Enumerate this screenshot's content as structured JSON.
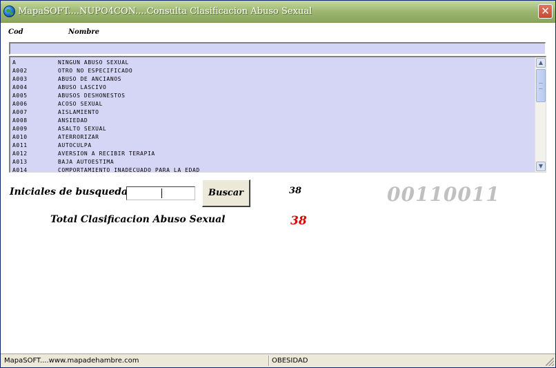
{
  "window": {
    "title": "MapaSOFT....NUPO4CON....Consulta  Clasificacion Abuso Sexual",
    "close_glyph": "✕"
  },
  "list": {
    "col_code": "Cod",
    "col_name": "Nombre",
    "search_value": "",
    "rows": [
      {
        "code": "A",
        "name": "NINGUN ABUSO SEXUAL"
      },
      {
        "code": "A002",
        "name": "OTRO NO ESPECIFICADO"
      },
      {
        "code": "A003",
        "name": "ABUSO DE ANCIANOS"
      },
      {
        "code": "A004",
        "name": "ABUSO LASCIVO"
      },
      {
        "code": "A005",
        "name": "ABUSOS DESHONESTOS"
      },
      {
        "code": "A006",
        "name": "ACOSO SEXUAL"
      },
      {
        "code": "A007",
        "name": "AISLAMIENTO"
      },
      {
        "code": "A008",
        "name": "ANSIEDAD"
      },
      {
        "code": "A009",
        "name": "ASALTO SEXUAL"
      },
      {
        "code": "A010",
        "name": "ATERRORIZAR"
      },
      {
        "code": "A011",
        "name": "AUTOCULPA"
      },
      {
        "code": "A012",
        "name": "AVERSION A RECIBIR TERAPIA"
      },
      {
        "code": "A013",
        "name": "BAJA AUTOESTIMA"
      },
      {
        "code": "A014",
        "name": "COMPORTAMIENTO INADECUADO PARA LA EDAD"
      }
    ],
    "scroll_up_glyph": "▲",
    "scroll_down_glyph": "▼"
  },
  "search": {
    "label": "Iniciales de busqueda",
    "input_value": "",
    "button_label": "Buscar",
    "result_count": "38",
    "binary_code": "00110011"
  },
  "total": {
    "label": "Total  Clasificacion Abuso Sexual",
    "value": "38"
  },
  "statusbar": {
    "left": "MapaSOFT....www.mapadehambre.com",
    "middle": "OBESIDAD"
  },
  "icons": {
    "app_icon": "globe-icon",
    "close": "close-icon",
    "scroll_up": "arrow-up-icon",
    "scroll_down": "arrow-down-icon",
    "grip": "resize-grip-icon"
  },
  "colors": {
    "titlebar": "#98b36c",
    "list_background": "#d5d6f6",
    "total_value": "#e00000",
    "binary_code": "#c0c0c0"
  }
}
